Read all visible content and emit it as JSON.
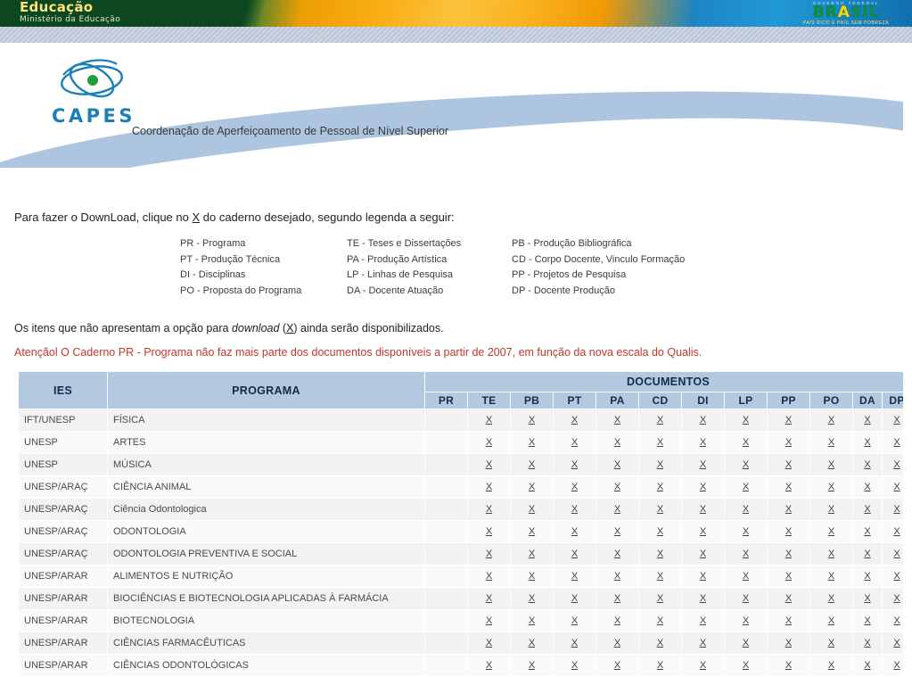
{
  "gov_banner": {
    "title": "Educação",
    "subtitle": "Ministério da Educação",
    "brasil_top": "GOVERNO FEDERAL",
    "brasil_main_1": "BR",
    "brasil_main_2": "A",
    "brasil_main_3": "SIL",
    "brasil_tagline": "PAÍS RICO É PAÍS SEM POBREZA",
    "green": "#0d5a2a",
    "yellow": "#ffc63a",
    "blue": "#1a86c8"
  },
  "header": {
    "logo_word": "CAPES",
    "subtitle": "Coordenação de Aperfeiçoamento de Pessoal de Nível Superior",
    "accent": "#1b7fb5",
    "wave_color": "#a9c2dd"
  },
  "intro": {
    "before": "Para fazer o DownLoad, clique no ",
    "link": "X",
    "after": " do caderno desejado, segundo legenda a seguir:"
  },
  "legend": {
    "col1": [
      "PR - Programa",
      "PT - Produção Técnica",
      "DI - Disciplinas",
      "PO - Proposta do Programa"
    ],
    "col2": [
      "TE - Teses e Dissertações",
      "PA - Produção Artística",
      "LP - Linhas de Pesquisa",
      "DA - Docente Atuação"
    ],
    "col3": [
      "PB - Produção Bibliográfica",
      "CD - Corpo Docente, Vinculo Formação",
      "PP - Projetos de Pesquisa",
      "DP - Docente Produção"
    ]
  },
  "note": {
    "p1_a": "Os itens que não apresentam a opção para ",
    "p1_em": "download",
    "p1_b": " (",
    "p1_x": "X",
    "p1_c": ") ainda serão disponibilizados.",
    "warning": "Atençãol O Caderno PR - Programa não faz mais parte dos documentos disponíveis a partir de 2007, em função da nova escala do Qualis.",
    "warning_color": "#c0392b"
  },
  "table": {
    "head": {
      "ies": "IES",
      "programa": "PROGRAMA",
      "documentos": "DOCUMENTOS",
      "columns": [
        "PR",
        "TE",
        "PB",
        "PT",
        "PA",
        "CD",
        "DI",
        "LP",
        "PP",
        "PO",
        "DA",
        "DP"
      ]
    },
    "link_label": "X",
    "header_bg": "#b3c9e0",
    "row_bg": "#f2f2f2",
    "rows": [
      {
        "ies": "IFT/UNESP",
        "programa": "FÍSICA",
        "docs": [
          "",
          "X",
          "X",
          "X",
          "X",
          "X",
          "X",
          "X",
          "X",
          "X",
          "X",
          "X"
        ]
      },
      {
        "ies": "UNESP",
        "programa": "ARTES",
        "docs": [
          "",
          "X",
          "X",
          "X",
          "X",
          "X",
          "X",
          "X",
          "X",
          "X",
          "X",
          "X"
        ]
      },
      {
        "ies": "UNESP",
        "programa": "MÚSICA",
        "docs": [
          "",
          "X",
          "X",
          "X",
          "X",
          "X",
          "X",
          "X",
          "X",
          "X",
          "X",
          "X"
        ]
      },
      {
        "ies": "UNESP/ARAÇ",
        "programa": "CIÊNCIA ANIMAL",
        "docs": [
          "",
          "X",
          "X",
          "X",
          "X",
          "X",
          "X",
          "X",
          "X",
          "X",
          "X",
          "X"
        ]
      },
      {
        "ies": "UNESP/ARAÇ",
        "programa": "Ciência Odontologica",
        "docs": [
          "",
          "X",
          "X",
          "X",
          "X",
          "X",
          "X",
          "X",
          "X",
          "X",
          "X",
          "X"
        ]
      },
      {
        "ies": "UNESP/ARAÇ",
        "programa": "ODONTOLOGIA",
        "docs": [
          "",
          "X",
          "X",
          "X",
          "X",
          "X",
          "X",
          "X",
          "X",
          "X",
          "X",
          "X"
        ]
      },
      {
        "ies": "UNESP/ARAÇ",
        "programa": "ODONTOLOGIA PREVENTIVA E SOCIAL",
        "docs": [
          "",
          "X",
          "X",
          "X",
          "X",
          "X",
          "X",
          "X",
          "X",
          "X",
          "X",
          "X"
        ]
      },
      {
        "ies": "UNESP/ARAR",
        "programa": "ALIMENTOS E NUTRIÇÃO",
        "docs": [
          "",
          "X",
          "X",
          "X",
          "X",
          "X",
          "X",
          "X",
          "X",
          "X",
          "X",
          "X"
        ]
      },
      {
        "ies": "UNESP/ARAR",
        "programa": "BIOCIÊNCIAS E BIOTECNOLOGIA APLICADAS À FARMÁCIA",
        "docs": [
          "",
          "X",
          "X",
          "X",
          "X",
          "X",
          "X",
          "X",
          "X",
          "X",
          "X",
          "X"
        ]
      },
      {
        "ies": "UNESP/ARAR",
        "programa": "BIOTECNOLOGIA",
        "docs": [
          "",
          "X",
          "X",
          "X",
          "X",
          "X",
          "X",
          "X",
          "X",
          "X",
          "X",
          "X"
        ]
      },
      {
        "ies": "UNESP/ARAR",
        "programa": "CIÊNCIAS FARMACÊUTICAS",
        "docs": [
          "",
          "X",
          "X",
          "X",
          "X",
          "X",
          "X",
          "X",
          "X",
          "X",
          "X",
          "X"
        ]
      },
      {
        "ies": "UNESP/ARAR",
        "programa": "CIÊNCIAS ODONTOLÓGICAS",
        "docs": [
          "",
          "X",
          "X",
          "X",
          "X",
          "X",
          "X",
          "X",
          "X",
          "X",
          "X",
          "X"
        ]
      }
    ]
  }
}
